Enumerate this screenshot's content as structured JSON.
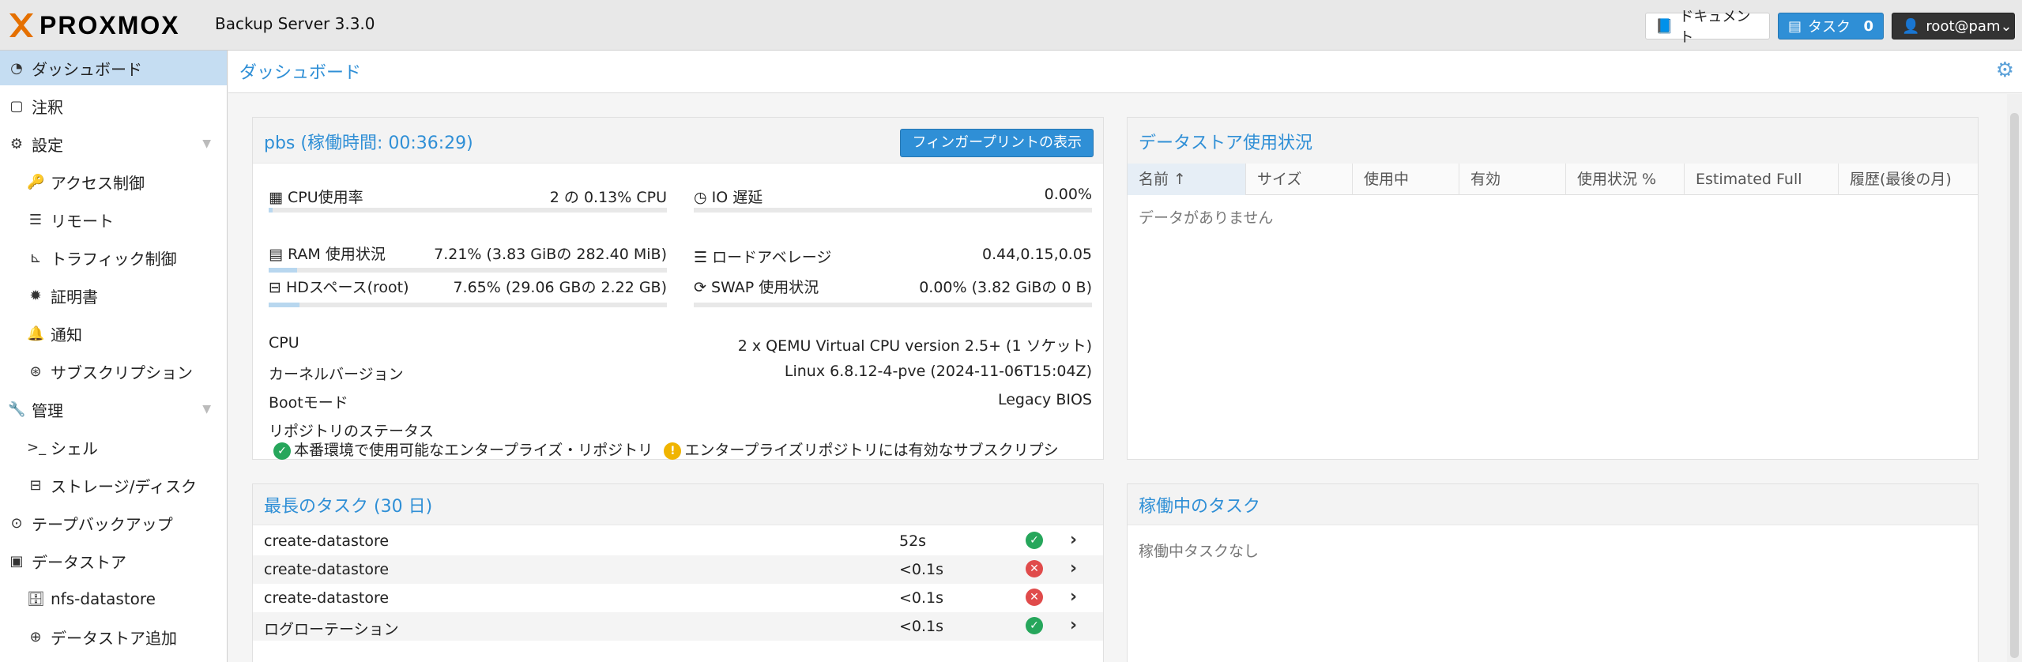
{
  "header": {
    "logo_text": "PROXMOX",
    "product": "Backup Server 3.3.0",
    "docs_label": "ドキュメント",
    "tasks_label": "タスク",
    "tasks_count": "0",
    "user_label": "root@pam"
  },
  "sidebar": {
    "items": [
      {
        "label": "ダッシュボード"
      },
      {
        "label": "注釈"
      },
      {
        "label": "設定"
      },
      {
        "label": "アクセス制御"
      },
      {
        "label": "リモート"
      },
      {
        "label": "トラフィック制御"
      },
      {
        "label": "証明書"
      },
      {
        "label": "通知"
      },
      {
        "label": "サブスクリプション"
      },
      {
        "label": "管理"
      },
      {
        "label": "シェル"
      },
      {
        "label": "ストレージ/ディスク"
      },
      {
        "label": "テープバックアップ"
      },
      {
        "label": "データストア"
      },
      {
        "label": "nfs-datastore"
      },
      {
        "label": "データストア追加"
      }
    ]
  },
  "main": {
    "title": "ダッシュボード"
  },
  "server_panel": {
    "title": "pbs (稼働時間: 00:36:29)",
    "fingerprint_button": "フィンガープリントの表示",
    "cpu_label": "CPU使用率",
    "cpu_value": "2 の 0.13% CPU",
    "io_label": "IO 遅延",
    "io_value": "0.00%",
    "ram_label": "RAM 使用状況",
    "ram_value": "7.21% (3.83 GiBの 282.40 MiB)",
    "load_label": "ロードアベレージ",
    "load_value": "0.44,0.15,0.05",
    "hd_label": "HDスペース(root)",
    "hd_value": "7.65% (29.06 GBの 2.22 GB)",
    "swap_label": "SWAP 使用状況",
    "swap_value": "0.00% (3.82 GiBの 0 B)",
    "cpu_info_label": "CPU",
    "cpu_info_value": "2 x QEMU Virtual CPU version 2.5+ (1 ソケット)",
    "kernel_label": "カーネルバージョン",
    "kernel_value": "Linux 6.8.12-4-pve (2024-11-06T15:04Z)",
    "boot_label": "Bootモード",
    "boot_value": "Legacy BIOS",
    "repo_label": "リポジトリのステータス",
    "repo_ok_text": "本番環境で使用可能なエンタープライズ・リポジトリ",
    "repo_warn_text": "エンタープライズリポジトリには有効なサブスクリプシ"
  },
  "datastore_panel": {
    "title": "データストア使用状況",
    "columns": [
      "名前 ↑",
      "サイズ",
      "使用中",
      "有効",
      "使用状況 %",
      "Estimated Full",
      "履歴(最後の月)"
    ],
    "empty_text": "データがありません"
  },
  "longest_tasks": {
    "title": "最長のタスク (30 日)",
    "rows": [
      {
        "name": "create-datastore",
        "duration": "52s",
        "status": "ok"
      },
      {
        "name": "create-datastore",
        "duration": "<0.1s",
        "status": "error"
      },
      {
        "name": "create-datastore",
        "duration": "<0.1s",
        "status": "error"
      },
      {
        "name": "ログローテーション",
        "duration": "<0.1s",
        "status": "ok"
      }
    ]
  },
  "running_tasks": {
    "title": "稼働中のタスク",
    "empty_text": "稼働中タスクなし"
  },
  "usage": {
    "cpu": 0.0013,
    "ram": 0.0721,
    "hd": 0.0765,
    "swap": 0.0
  },
  "colors": {
    "accent": "#2f8fd6",
    "ok": "#26a65b",
    "error": "#e04b4b",
    "warn": "#f0b400"
  },
  "icons": {
    "cpu": "chip-icon",
    "io": "clock-icon",
    "ram": "memory-icon",
    "load": "server-icon",
    "hd": "hdd-icon",
    "swap": "refresh-icon"
  }
}
